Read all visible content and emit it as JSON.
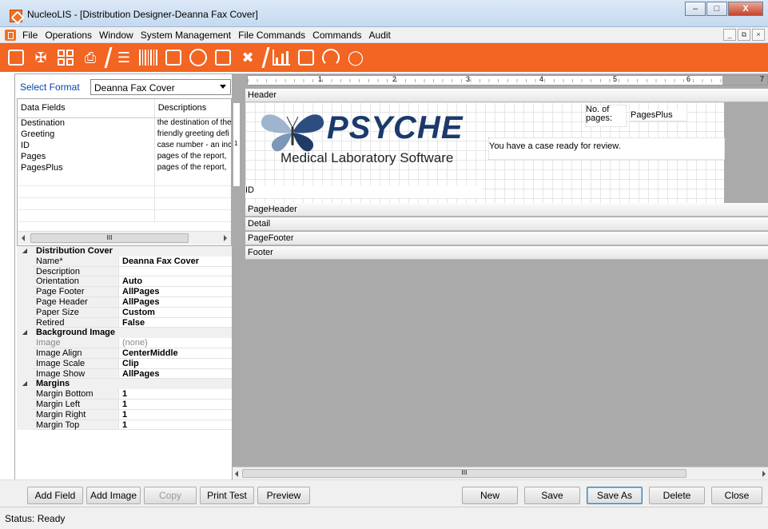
{
  "window": {
    "title": "NucleoLIS - [Distribution Designer-Deanna Fax Cover]",
    "controls": [
      "minimize",
      "maximize",
      "close"
    ],
    "close_glyph": "X"
  },
  "menu": {
    "items": [
      "File",
      "Operations",
      "Window",
      "System Management",
      "File Commands",
      "Commands",
      "Audit"
    ],
    "mdi_controls": [
      "_",
      "̅",
      "×"
    ]
  },
  "toolbar": {
    "color": "#f26522",
    "icons": [
      "add-case-icon",
      "dna-icon",
      "grid-icon",
      "printer-icon",
      "slides-icon",
      "barcode-icon",
      "document-icon",
      "at-icon",
      "window-icon",
      "tools-icon",
      "chart-icon",
      "calendar-add-icon",
      "gauge-icon",
      "shield-icon"
    ]
  },
  "left": {
    "select_label": "Select Format",
    "select_value": "Deanna Fax Cover",
    "data_fields": {
      "headers": [
        "Data Fields",
        "Descriptions"
      ],
      "rows": [
        [
          "Destination",
          "the destination of the"
        ],
        [
          "Greeting",
          "friendly greeting defi"
        ],
        [
          "ID",
          "case number - an inc"
        ],
        [
          "Pages",
          "pages of the report,"
        ],
        [
          "PagesPlus",
          "pages of the report,"
        ]
      ],
      "scroll_grip": "III"
    },
    "properties": [
      {
        "category": "Distribution Cover",
        "items": [
          {
            "name": "Name*",
            "value": "Deanna Fax Cover",
            "style": "bold"
          },
          {
            "name": "Description",
            "value": "",
            "style": "normal"
          },
          {
            "name": "Orientation",
            "value": "Auto",
            "style": "bold"
          },
          {
            "name": "Page Footer",
            "value": "AllPages",
            "style": "bold"
          },
          {
            "name": "Page Header",
            "value": "AllPages",
            "style": "bold"
          },
          {
            "name": "Paper Size",
            "value": "Custom",
            "style": "bold"
          },
          {
            "name": "Retired",
            "value": "False",
            "style": "bold"
          }
        ]
      },
      {
        "category": "Background Image",
        "items": [
          {
            "name": "Image",
            "value": "(none)",
            "style": "gray"
          },
          {
            "name": "Image Align",
            "value": "CenterMiddle",
            "style": "bold"
          },
          {
            "name": "Image Scale",
            "value": "Clip",
            "style": "bold"
          },
          {
            "name": "Image Show",
            "value": "AllPages",
            "style": "bold"
          }
        ]
      },
      {
        "category": "Margins",
        "items": [
          {
            "name": "Margin Bottom",
            "value": "1",
            "style": "bold"
          },
          {
            "name": "Margin Left",
            "value": "1",
            "style": "bold"
          },
          {
            "name": "Margin Right",
            "value": "1",
            "style": "bold"
          },
          {
            "name": "Margin Top",
            "value": "1",
            "style": "bold"
          }
        ]
      }
    ]
  },
  "designer": {
    "ruler_numbers": [
      "1",
      "2",
      "3",
      "4",
      "5",
      "6",
      "7"
    ],
    "vruler_number": "1",
    "bands": {
      "header": "Header",
      "page_header": "PageHeader",
      "detail": "Detail",
      "page_footer": "PageFooter",
      "footer": "Footer"
    },
    "logo": {
      "brand": "PSYCHE",
      "tagline": "Medical Laboratory Software"
    },
    "fields": {
      "no_of_pages": "No. of pages:",
      "pages_plus": "PagesPlus",
      "message": "You have a case ready for review.",
      "id": "ID"
    },
    "scroll_grip": "III"
  },
  "buttons": {
    "add_field": "Add Field",
    "add_image": "Add Image",
    "copy": "Copy",
    "print_test": "Print Test",
    "preview": "Preview",
    "new": "New",
    "save": "Save",
    "save_as": "Save As",
    "delete": "Delete",
    "close": "Close"
  },
  "status": "Status: Ready"
}
